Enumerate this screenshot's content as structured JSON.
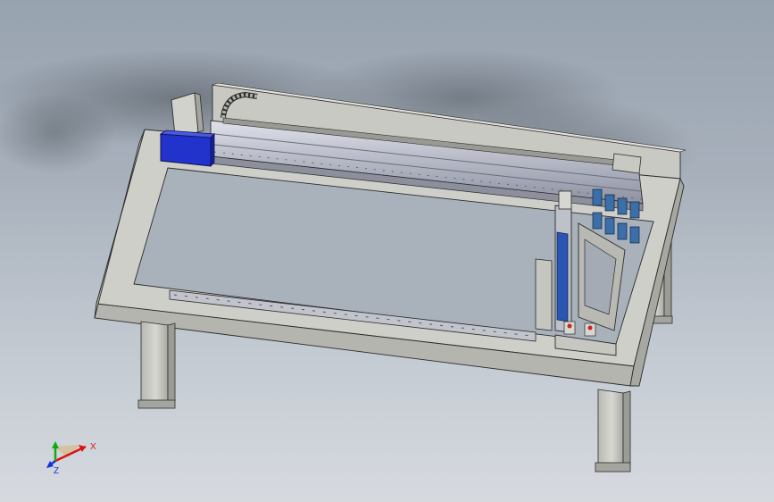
{
  "viewport": {
    "background_top": "#98a3b0",
    "background_bottom": "#d6dadf"
  },
  "model": {
    "frame_color": "#cfcfca",
    "frame_edge_color": "#2b2b2b",
    "rail_color": "#b9bcc6",
    "motor_color": "#2233cc",
    "cylinder_color": "#3a6fa8",
    "accent_red": "#cc2222"
  },
  "triad": {
    "x_label": "X",
    "y_label": "Y",
    "z_label": "Z",
    "x_color": "#dd1111",
    "y_color": "#11aa11",
    "z_color": "#1133dd"
  }
}
